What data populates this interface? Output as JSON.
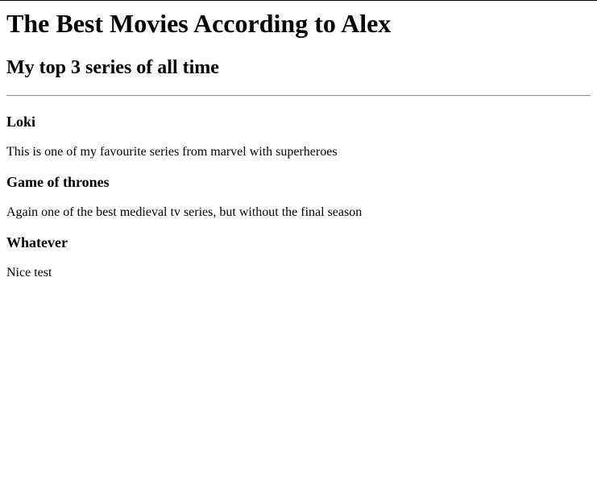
{
  "page": {
    "title": "The Best Movies According to Alex",
    "subtitle": "My top 3 series of all time"
  },
  "series": [
    {
      "name": "Loki",
      "description": "This is one of my favourite series from marvel with superheroes"
    },
    {
      "name": "Game of thrones",
      "description": "Again one of the best medieval tv series, but without the final season"
    },
    {
      "name": "Whatever",
      "description": "Nice test"
    }
  ]
}
